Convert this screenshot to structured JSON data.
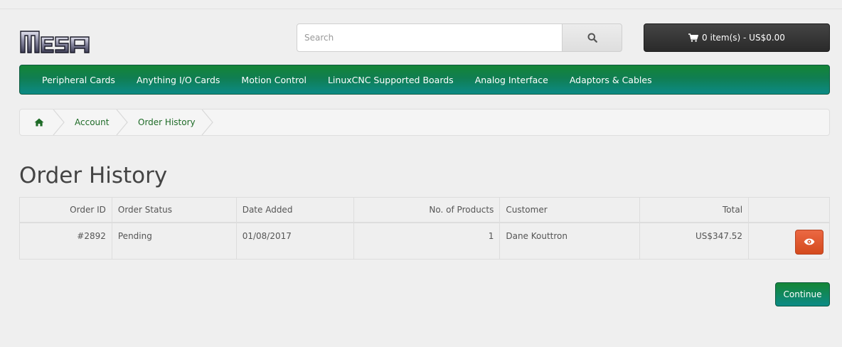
{
  "brand": {
    "logo_text": "Mesa"
  },
  "search": {
    "placeholder": "Search",
    "value": ""
  },
  "cart": {
    "label": "0 item(s) - US$0.00"
  },
  "menu": {
    "items": [
      {
        "label": "Peripheral Cards"
      },
      {
        "label": "Anything I/O Cards"
      },
      {
        "label": "Motion Control"
      },
      {
        "label": "LinuxCNC Supported Boards"
      },
      {
        "label": "Analog Interface"
      },
      {
        "label": "Adaptors & Cables"
      }
    ]
  },
  "breadcrumb": {
    "items": [
      {
        "label": "Account"
      },
      {
        "label": "Order History"
      }
    ]
  },
  "page": {
    "title": "Order History"
  },
  "table": {
    "headers": [
      "Order ID",
      "Order Status",
      "Date Added",
      "No. of Products",
      "Customer",
      "Total"
    ],
    "rows": [
      {
        "order_id": "#2892",
        "status": "Pending",
        "date_added": "01/08/2017",
        "products": "1",
        "customer": "Dane Kouttron",
        "total": "US$347.52"
      }
    ]
  },
  "actions": {
    "continue_label": "Continue"
  },
  "colors": {
    "menu_green": "#148536",
    "menu_teal": "#0c8a86",
    "view_button": "#e05a30",
    "link": "#1e6b27"
  },
  "icons": {
    "search": "search-icon",
    "cart": "cart-icon",
    "home": "home-icon",
    "view": "eye-icon"
  }
}
